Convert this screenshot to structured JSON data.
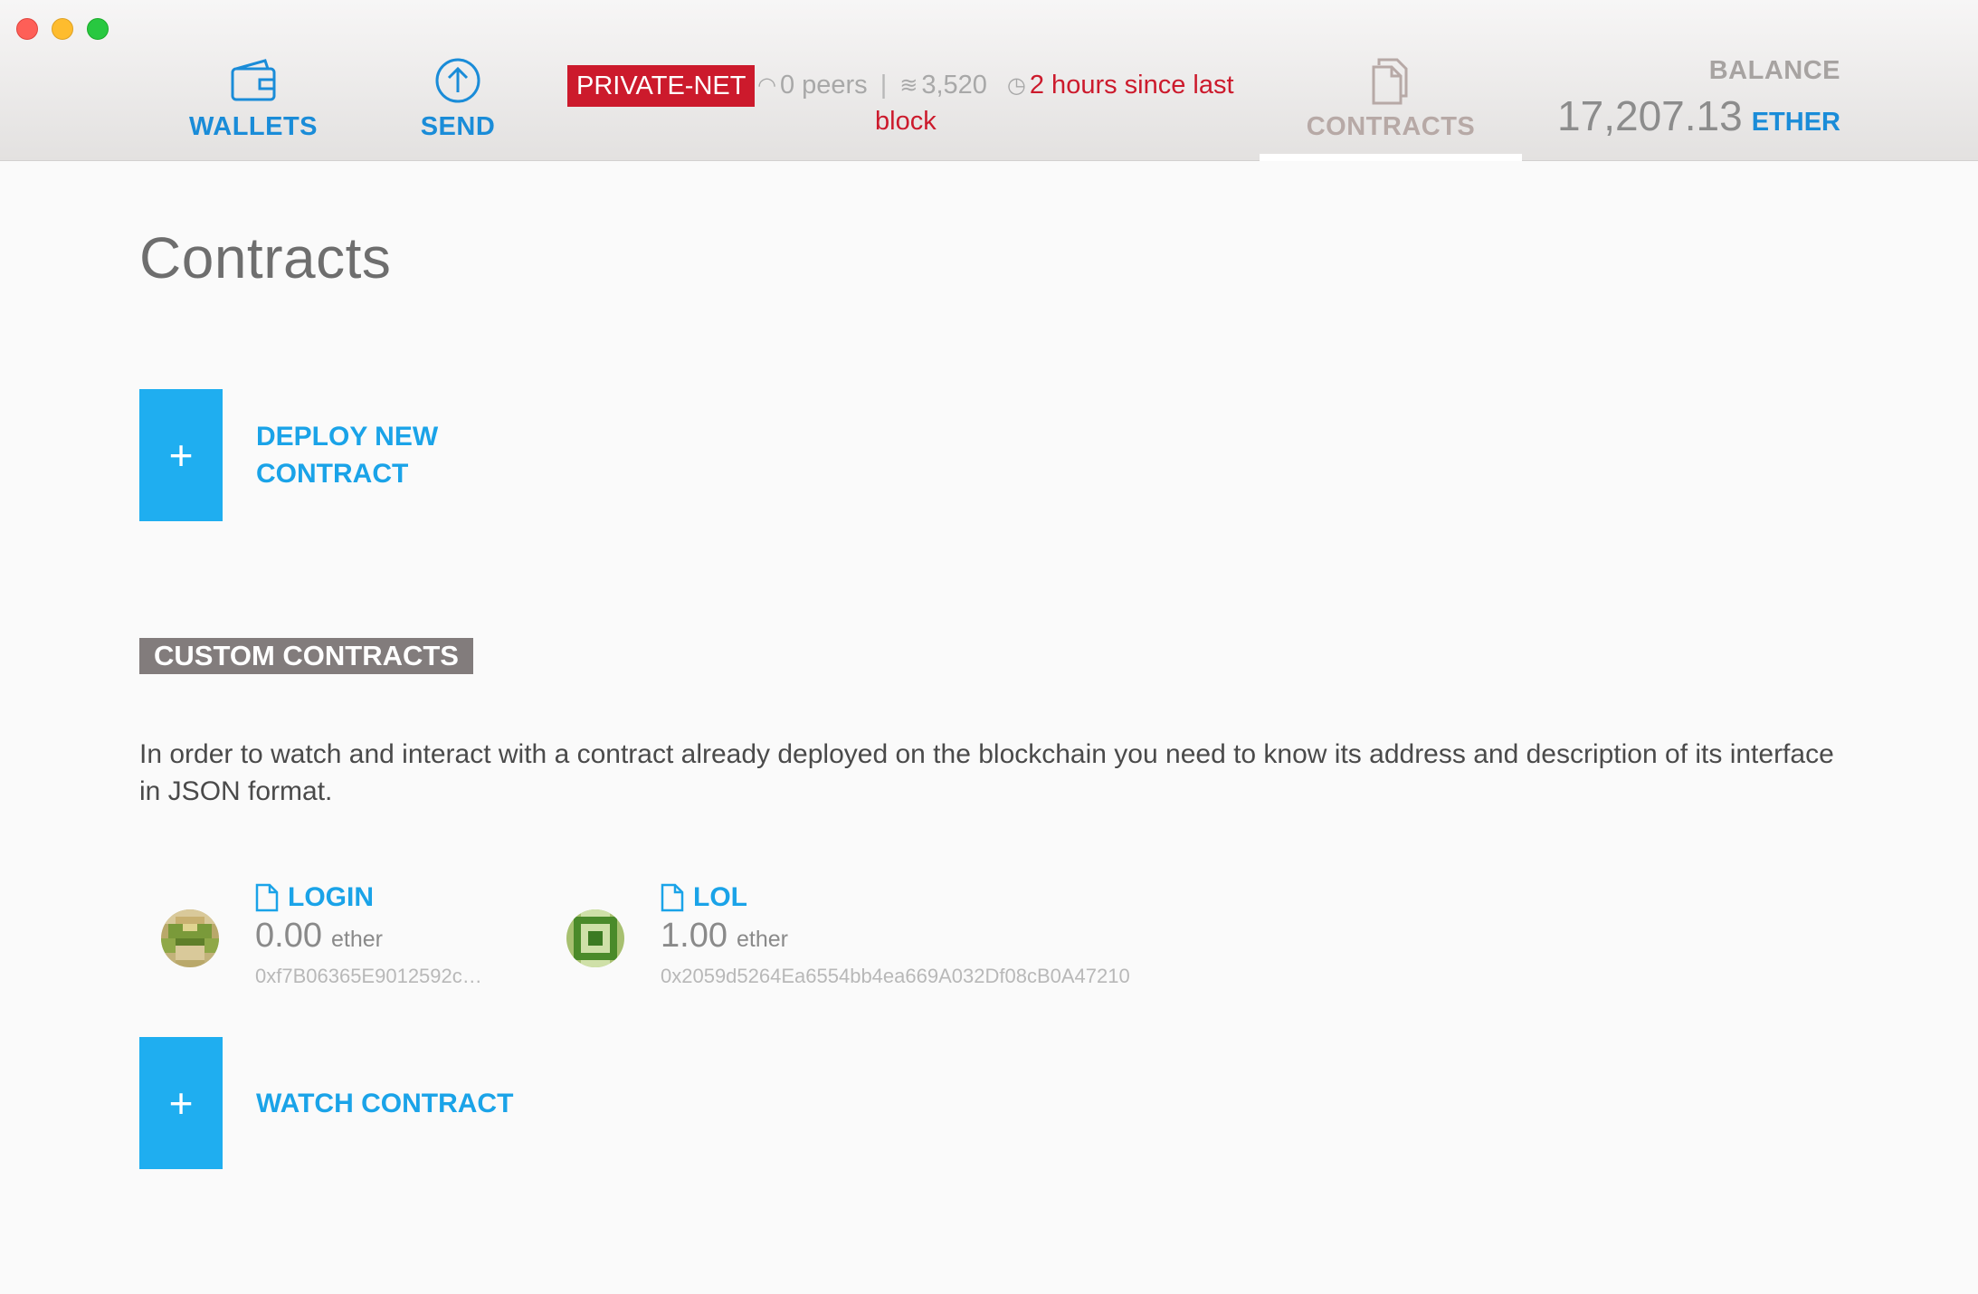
{
  "nav": {
    "wallets_label": "WALLETS",
    "send_label": "SEND",
    "contracts_label": "CONTRACTS"
  },
  "network": {
    "badge": "PRIVATE-NET",
    "peers": "0 peers",
    "separator": "|",
    "block_number": "3,520",
    "time_since": "2 hours since last",
    "time_since_tail": "block"
  },
  "balance": {
    "title": "BALANCE",
    "value": "17,207.13",
    "unit": "ETHER"
  },
  "page": {
    "title": "Contracts"
  },
  "deploy": {
    "icon": "+",
    "label": "DEPLOY NEW CONTRACT"
  },
  "custom": {
    "heading": "CUSTOM CONTRACTS",
    "description": "In order to watch and interact with a contract already deployed on the blockchain you need to know its address and description of its interface in JSON format."
  },
  "contracts": [
    {
      "name": "LOGIN",
      "value": "0.00",
      "unit": "ether",
      "address": "0xf7B06365E9012592c…"
    },
    {
      "name": "LOL",
      "value": "1.00",
      "unit": "ether",
      "address": "0x2059d5264Ea6554bb4ea669A032Df08cB0A47210"
    }
  ],
  "watch": {
    "icon": "+",
    "label": "WATCH CONTRACT"
  },
  "colors": {
    "accent": "#1aa3e8",
    "danger": "#cc1a2c",
    "badge_gray": "#827c7c"
  },
  "icons": [
    "wallet-icon",
    "send-arrow-icon",
    "contracts-document-icon",
    "peers-signal-icon",
    "blocks-layers-icon",
    "clock-icon",
    "document-icon"
  ]
}
